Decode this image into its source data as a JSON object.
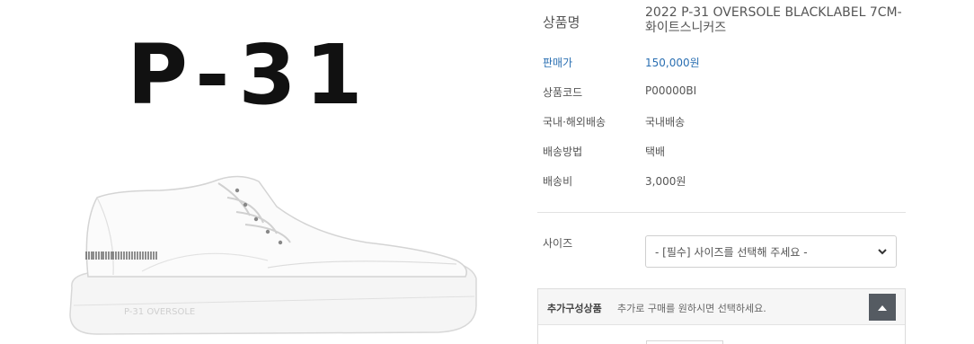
{
  "product_image": {
    "brand_text": "P-31",
    "sole_text": "P-31 OVERSOLE"
  },
  "info": {
    "name_label": "상품명",
    "name_value": "2022 P-31 OVERSOLE BLACKLABEL 7CM- 화이트스니커즈",
    "price_label": "판매가",
    "price_value": "150,000원",
    "code_label": "상품코드",
    "code_value": "P00000BI",
    "shipping_region_label": "국내·해외배송",
    "shipping_region_value": "국내배송",
    "shipping_method_label": "배송방법",
    "shipping_method_value": "택배",
    "shipping_fee_label": "배송비",
    "shipping_fee_value": "3,000원"
  },
  "options": {
    "size_label": "사이즈",
    "size_selected": "- [필수] 사이즈를 선택해 주세요 -"
  },
  "addon": {
    "title": "추가구성상품",
    "description": "추가로 구매를 원하시면 선택하세요."
  },
  "colors": {
    "price_blue": "#2a6fb2",
    "toggle_dark": "#555b62"
  },
  "icons": {
    "select_chevron": "chevron-down-icon",
    "addon_toggle": "chevron-up-icon"
  }
}
